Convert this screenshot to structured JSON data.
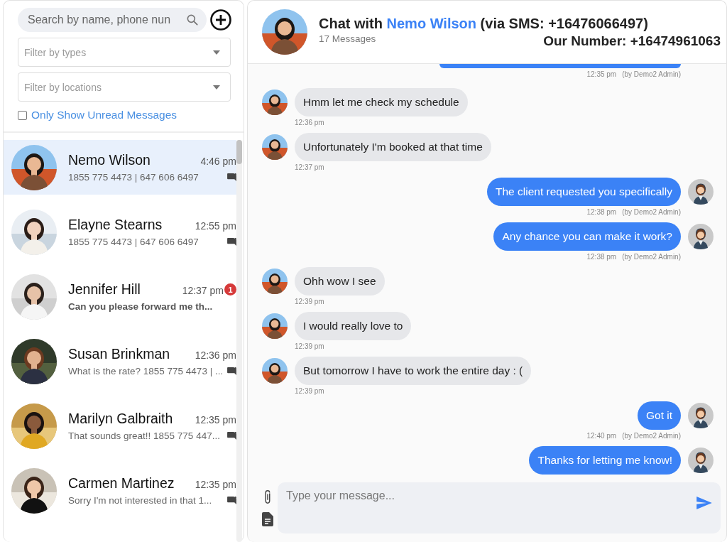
{
  "sidebar": {
    "search": {
      "placeholder": "Search by name, phone nun"
    },
    "filters": [
      {
        "placeholder": "Filter by types"
      },
      {
        "placeholder": "Filter by locations"
      }
    ],
    "unread_only": {
      "label": "Only Show Unread Messages",
      "checked": false
    },
    "contacts": [
      {
        "name": "Nemo Wilson",
        "time": "4:46 pm",
        "preview": "1855 775 4473 | 647 606 6497",
        "unread": false,
        "selected": true
      },
      {
        "name": "Elayne Stearns",
        "time": "12:55 pm",
        "preview": "1855 775 4473 | 647 606 6497",
        "unread": false,
        "selected": false
      },
      {
        "name": "Jennifer Hill",
        "time": "12:37 pm",
        "preview": "Can you please forward me th...",
        "unread": true,
        "badge": "1",
        "selected": false
      },
      {
        "name": "Susan Brinkman",
        "time": "12:36 pm",
        "preview": "What is the rate? 1855 775 4473 | ...",
        "unread": false,
        "selected": false
      },
      {
        "name": "Marilyn Galbraith",
        "time": "12:35 pm",
        "preview": "That sounds great!! 1855 775 447...",
        "unread": false,
        "selected": false
      },
      {
        "name": "Carmen Martinez",
        "time": "12:35 pm",
        "preview": "Sorry I'm not interested in that 1...",
        "unread": false,
        "selected": false
      }
    ]
  },
  "chat": {
    "title_prefix": "Chat with",
    "contact_name": "Nemo Wilson",
    "channel": "(via SMS: +16476066497)",
    "message_count": "17 Messages",
    "our_number": "Our Number: +16474961063",
    "messages": [
      {
        "kind": "cut",
        "outgoing": true,
        "time": "12:35 pm",
        "by": "(by Demo2 Admin)"
      },
      {
        "kind": "full",
        "outgoing": false,
        "text": "Hmm let me check my schedule",
        "time": "12:36 pm"
      },
      {
        "kind": "full",
        "outgoing": false,
        "text": "Unfortunately I'm booked at that time",
        "time": "12:37 pm"
      },
      {
        "kind": "full",
        "outgoing": true,
        "text": "The client requested you specifically",
        "time": "12:38 pm",
        "by": "(by Demo2 Admin)"
      },
      {
        "kind": "full",
        "outgoing": true,
        "text": "Any chance you can make it work?",
        "time": "12:38 pm",
        "by": "(by Demo2 Admin)"
      },
      {
        "kind": "full",
        "outgoing": false,
        "text": "Ohh wow I see",
        "time": "12:39 pm"
      },
      {
        "kind": "full",
        "outgoing": false,
        "text": "I would really love to",
        "time": "12:39 pm"
      },
      {
        "kind": "full",
        "outgoing": false,
        "text": "But tomorrow I have to work the entire day : (",
        "time": "12:39 pm"
      },
      {
        "kind": "full",
        "outgoing": true,
        "text": "Got it",
        "time": "12:40 pm",
        "by": "(by Demo2 Admin)"
      },
      {
        "kind": "full",
        "outgoing": true,
        "text": "Thanks for letting me know!"
      }
    ],
    "composer": {
      "placeholder": "Type your message..."
    }
  }
}
